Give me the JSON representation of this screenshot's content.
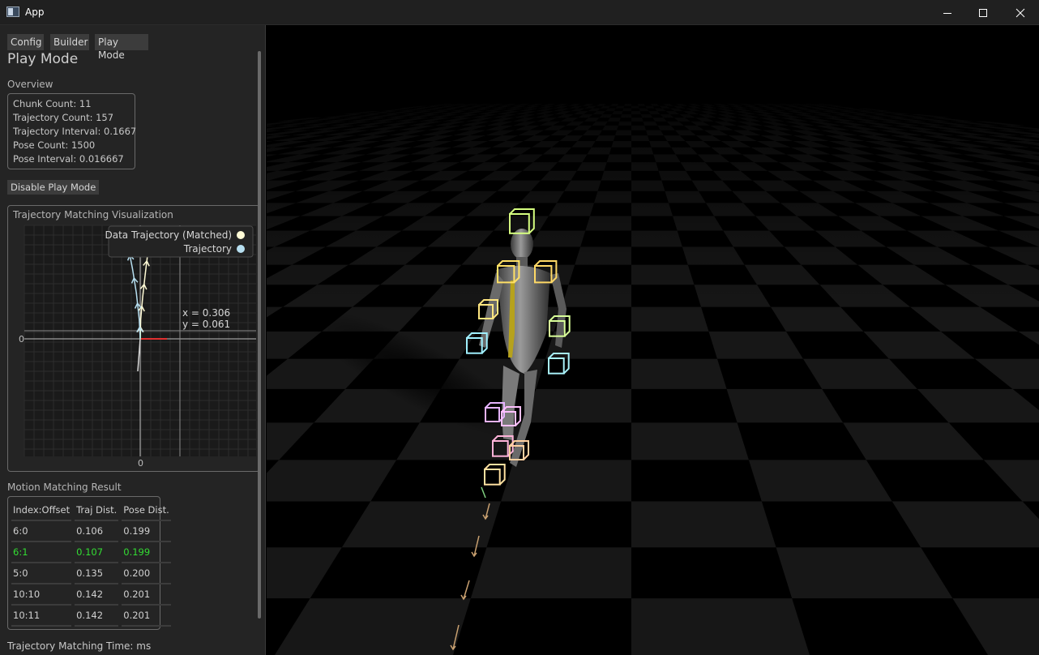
{
  "window": {
    "title": "App",
    "icons": {
      "app": "app-icon",
      "minimize": "minimize-icon",
      "maximize": "maximize-icon",
      "close": "close-icon"
    }
  },
  "tabs": {
    "config": "Config",
    "builder": "Builder",
    "play_mode": "Play Mode"
  },
  "panel_title": "Play Mode",
  "overview": {
    "label": "Overview",
    "lines": [
      "Chunk Count: 11",
      "Trajectory Count: 157",
      "Trajectory Interval: 0.1667",
      "Pose Count: 1500",
      "Pose Interval: 0.016667"
    ]
  },
  "disable_button": "Disable Play Mode",
  "visualization": {
    "title": "Trajectory Matching Visualization",
    "legend": [
      {
        "name": "Data Trajectory (Matched)",
        "color": "#fffbd6"
      },
      {
        "name": "Trajectory",
        "color": "#b7dff0"
      }
    ],
    "tooltip": {
      "x": "x = 0.306",
      "y": "y = 0.061"
    },
    "x_zero_label": "0",
    "y_zero_label": "0"
  },
  "chart_data": {
    "type": "line",
    "title": "Trajectory Matching Visualization",
    "xlabel": "",
    "ylabel": "",
    "series": [
      {
        "name": "Data Trajectory (Matched)",
        "color": "#fffbd6",
        "x": [
          0,
          0.01,
          0.05,
          0.1,
          0.16
        ],
        "y": [
          0,
          0.4,
          0.85,
          1.3,
          1.8
        ]
      },
      {
        "name": "Trajectory",
        "color": "#b7dff0",
        "x": [
          0,
          -0.02,
          -0.08,
          -0.16,
          -0.25
        ],
        "y": [
          0,
          0.4,
          0.95,
          1.45,
          1.9
        ]
      }
    ]
  },
  "motion_matching": {
    "label": "Motion Matching Result",
    "headers": [
      "Index:Offset",
      "Traj Dist.",
      "Pose Dist."
    ],
    "rows": [
      [
        "6:0",
        "0.106",
        "0.199"
      ],
      [
        "6:1",
        "0.107",
        "0.199"
      ],
      [
        "5:0",
        "0.135",
        "0.200"
      ],
      [
        "10:10",
        "0.142",
        "0.201"
      ],
      [
        "10:11",
        "0.142",
        "0.201"
      ]
    ],
    "matched_row_index": 1,
    "matched_color": "#33dd33"
  },
  "matching_time_label": "Trajectory Matching Time:  ms",
  "scene": {
    "floor": "checkerboard-floor",
    "character": "humanoid-character",
    "markers": "joint-marker-cubes"
  }
}
